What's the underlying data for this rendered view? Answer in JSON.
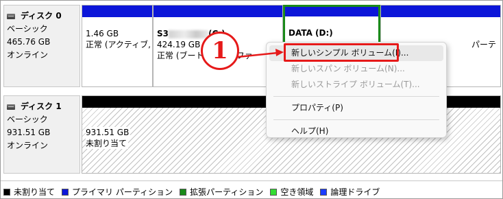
{
  "disks": [
    {
      "name": "ディスク 0",
      "type": "ベーシック",
      "size": "465.76 GB",
      "status": "オンライン",
      "partitions": [
        {
          "size": "1.46 GB",
          "status": "正常 (アクティブ,"
        },
        {
          "name_prefix": "S3",
          "name_suffix": "(C:)",
          "size": "424.19 GB NTFS",
          "status": "正常 (ブート, ページ ファ"
        },
        {
          "name": "DATA  (D:)"
        },
        {
          "status_tail": "パーテ"
        }
      ]
    },
    {
      "name": "ディスク 1",
      "type": "ベーシック",
      "size": "931.51 GB",
      "status": "オンライン",
      "unallocated": {
        "size": "931.51 GB",
        "label": "未割り当て"
      }
    }
  ],
  "legend": [
    {
      "label": "未割り当て",
      "color": "#000000"
    },
    {
      "label": "プライマリ パーティション",
      "color": "#0c16d9"
    },
    {
      "label": "拡張パーティション",
      "color": "#1a8a1a"
    },
    {
      "label": "空き領域",
      "color": "#33dd33"
    },
    {
      "label": "論理ドライブ",
      "color": "#1a3cff"
    }
  ],
  "context_menu": {
    "new_simple_volume": "新しいシンプル ボリューム(I)...",
    "new_spanned_volume": "新しいスパン ボリューム(N)...",
    "new_striped_volume": "新しいストライプ ボリューム(T)...",
    "properties": "プロパティ(P)",
    "help": "ヘルプ(H)"
  },
  "annotation": {
    "step_number": "1",
    "color": "#e61919"
  }
}
